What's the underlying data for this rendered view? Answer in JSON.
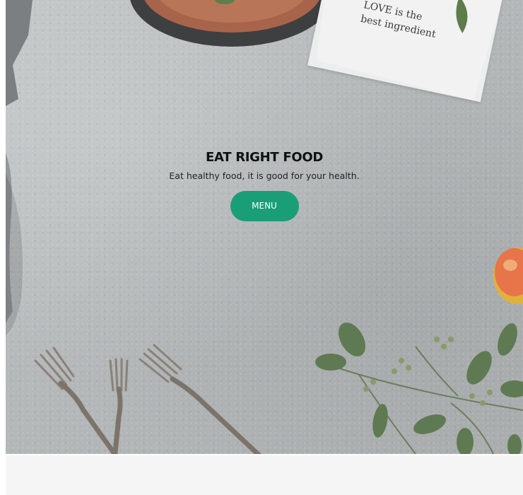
{
  "hero": {
    "title": "EAT RIGHT FOOD",
    "subtitle": "Eat healthy food, it is good for your health.",
    "cta_label": "MENU",
    "napkin_text_line1": "LOVE is the",
    "napkin_text_line2": "best ingredient"
  },
  "colors": {
    "accent": "#1a9e78",
    "background_band": "#f5f5f5"
  },
  "icons": [
    "plate-icon",
    "napkin-icon",
    "fork-icon",
    "apple-icon",
    "eucalyptus-icon",
    "cloth-icon"
  ]
}
